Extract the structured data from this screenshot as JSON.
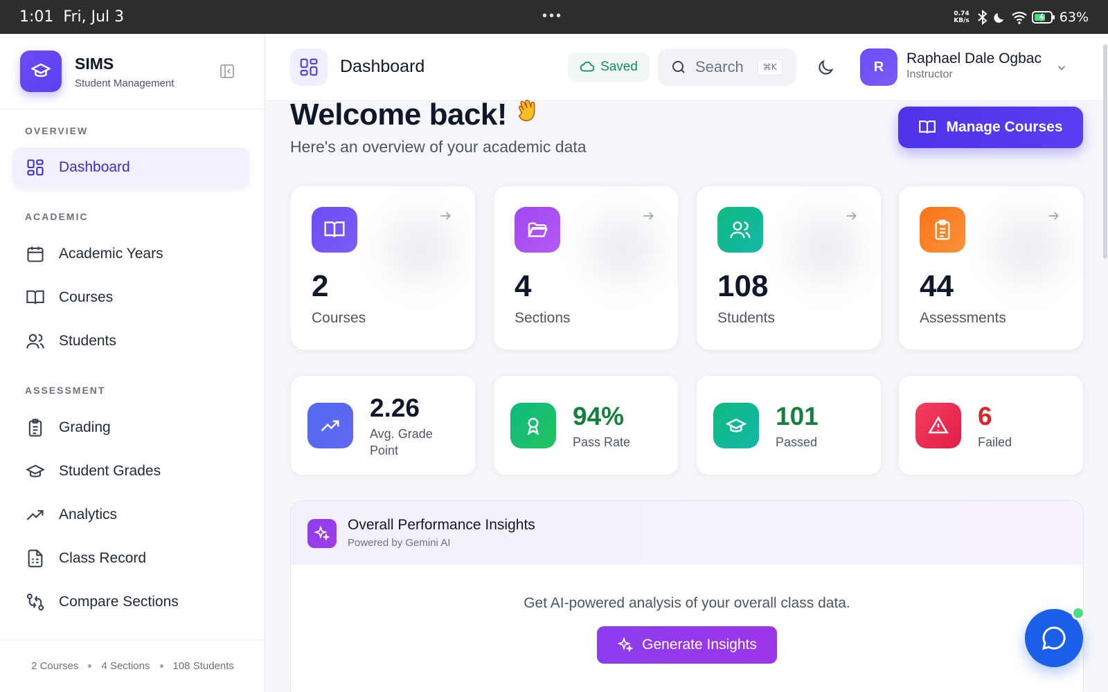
{
  "status_bar": {
    "time": "1:01",
    "date": "Fri, Jul 3",
    "dots": "•••",
    "speed_top": "0.74",
    "speed_bottom": "KB/s",
    "battery": "63%"
  },
  "brand": {
    "name": "SIMS",
    "subtitle": "Student Management"
  },
  "sidebar": {
    "sections": [
      {
        "title": "OVERVIEW",
        "items": [
          {
            "label": "Dashboard",
            "icon": "dashboard-icon",
            "active": true
          }
        ]
      },
      {
        "title": "ACADEMIC",
        "items": [
          {
            "label": "Academic Years",
            "icon": "calendar-icon"
          },
          {
            "label": "Courses",
            "icon": "book-icon"
          },
          {
            "label": "Students",
            "icon": "users-icon"
          }
        ]
      },
      {
        "title": "ASSESSMENT",
        "items": [
          {
            "label": "Grading",
            "icon": "clipboard-icon"
          },
          {
            "label": "Student Grades",
            "icon": "graduation-cap-icon"
          },
          {
            "label": "Analytics",
            "icon": "trending-up-icon"
          },
          {
            "label": "Class Record",
            "icon": "file-sheet-icon"
          },
          {
            "label": "Compare Sections",
            "icon": "compare-icon"
          }
        ]
      }
    ],
    "footer": {
      "courses": "2 Courses",
      "sections": "4 Sections",
      "students": "108 Students"
    }
  },
  "header": {
    "title": "Dashboard",
    "saved_label": "Saved",
    "search_placeholder": "Search",
    "search_shortcut": "⌘K",
    "user": {
      "initial": "R",
      "name": "Raphael Dale Ogbac",
      "role": "Instructor"
    }
  },
  "main": {
    "welcome_title": "Welcome back!",
    "welcome_subtitle": "Here's an overview of your academic data",
    "manage_button": "Manage Courses",
    "stats": [
      {
        "value": "2",
        "label": "Courses",
        "icon": "book-icon",
        "color": "#6d4cf5"
      },
      {
        "value": "4",
        "label": "Sections",
        "icon": "folder-icon",
        "color": "#a147f0"
      },
      {
        "value": "108",
        "label": "Students",
        "icon": "users-icon",
        "color": "#10b981"
      },
      {
        "value": "44",
        "label": "Assessments",
        "icon": "clipboard-icon",
        "color": "#f97316"
      }
    ],
    "metrics": [
      {
        "value": "2.26",
        "label_line1": "Avg. Grade",
        "label_line2": "Point",
        "icon": "trending-up-icon",
        "color": "#4f6cf0",
        "value_color": "#0f172a"
      },
      {
        "value": "94%",
        "label_line1": "Pass Rate",
        "icon": "award-icon",
        "color": "#10b981",
        "value_color": "#15803d"
      },
      {
        "value": "101",
        "label_line1": "Passed",
        "icon": "graduation-cap-icon",
        "color": "#10b981",
        "value_color": "#15803d"
      },
      {
        "value": "6",
        "label_line1": "Failed",
        "icon": "alert-triangle-icon",
        "color": "#f43f5e",
        "value_color": "#dc2626"
      }
    ],
    "insights": {
      "title": "Overall Performance Insights",
      "subtitle": "Powered by Gemini AI",
      "description": "Get AI-powered analysis of your overall class data.",
      "button": "Generate Insights"
    }
  }
}
